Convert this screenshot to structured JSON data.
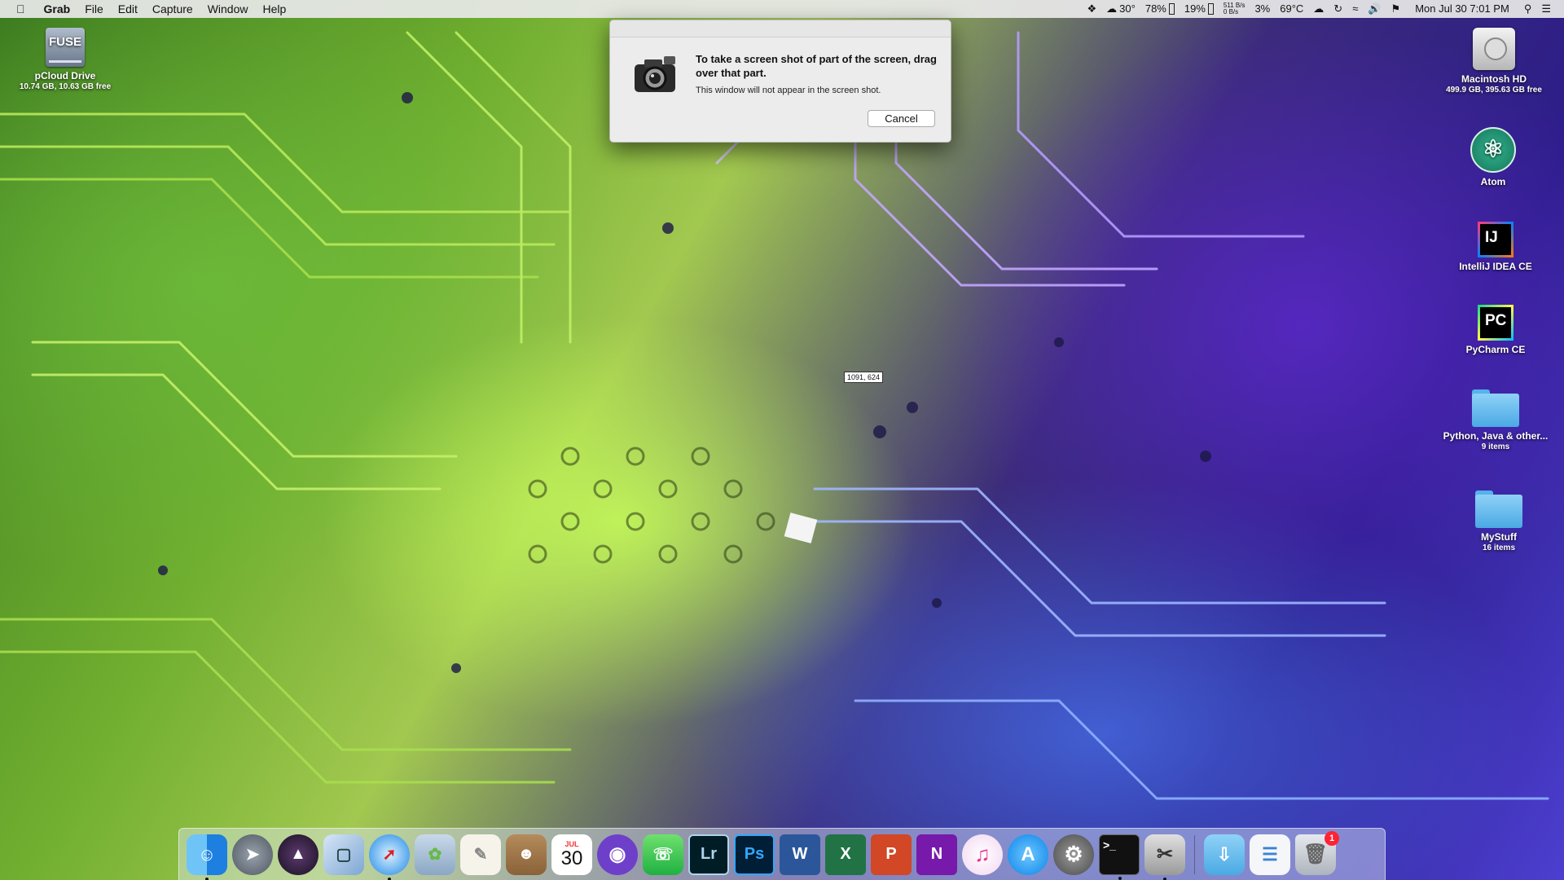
{
  "menubar": {
    "apple_icon": "apple-icon",
    "app_name": "Grab",
    "menus": [
      "File",
      "Edit",
      "Capture",
      "Window",
      "Help"
    ],
    "status": {
      "weather_temp": "30°",
      "battery1": "78%",
      "battery2": "19%",
      "net_up": "511 B/s",
      "net_down": "0 B/s",
      "cpu": "3%",
      "cpu_temp": "69°C",
      "clock": "Mon Jul 30  7:01 PM"
    }
  },
  "dialog": {
    "message": "To take a screen shot of part of the screen, drag over that part.",
    "subtext": "This window will not appear in the screen shot.",
    "cancel_label": "Cancel",
    "icon": "camera-icon"
  },
  "cursor": {
    "coords": "1091, 624"
  },
  "desktop_icons": {
    "pcloud": {
      "name": "pCloud Drive",
      "sub": "10.74 GB, 10.63 GB free",
      "badge": "FUSE"
    },
    "hd": {
      "name": "Macintosh HD",
      "sub": "499.9 GB, 395.63 GB free"
    },
    "atom": {
      "name": "Atom"
    },
    "intellij": {
      "name": "IntelliJ IDEA CE",
      "glyph": "IJ"
    },
    "pycharm": {
      "name": "PyCharm CE",
      "glyph": "PC"
    },
    "folder1": {
      "name": "Python, Java & other...",
      "sub": "9 items"
    },
    "folder2": {
      "name": "MyStuff",
      "sub": "16 items"
    }
  },
  "dock": {
    "calendar_month": "JUL",
    "calendar_day": "30",
    "lightroom": "Lr",
    "photoshop": "Ps",
    "word": "W",
    "excel": "X",
    "powerpoint": "P",
    "onenote": "N",
    "trash_badge": "1"
  }
}
